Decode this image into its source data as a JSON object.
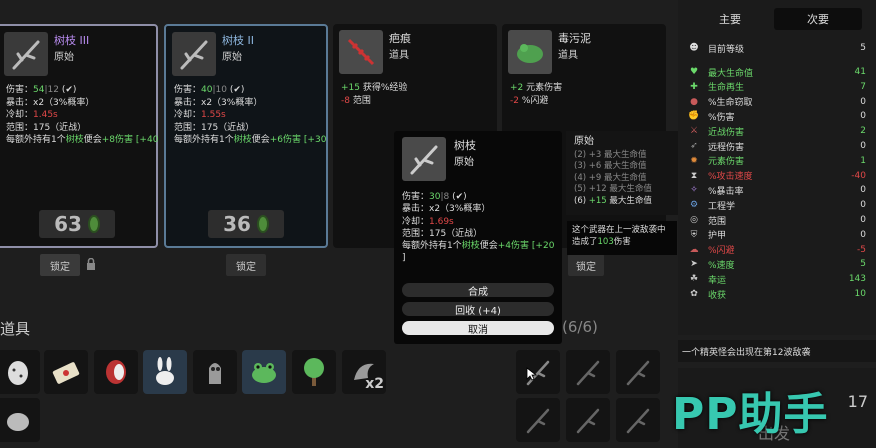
{
  "shop": {
    "card1": {
      "name": "树枝 III",
      "tier": "原始",
      "lines": [
        "伤害：",
        "54",
        "|",
        "12",
        "(",
        "✔",
        ")",
        "暴击：x2（3%概率）",
        "冷却：",
        "1.45s",
        "范围：175（近战）",
        "每额外持有1个",
        "树枝",
        "使会",
        "+8伤害",
        "[+40",
        "]"
      ],
      "price": "63",
      "lock_label": "锁定"
    },
    "card2": {
      "name": "树枝 II",
      "tier": "原始",
      "price": "36",
      "lock_label": "锁定"
    },
    "card3": {
      "name": "疤痕",
      "tier": "道具",
      "line1_prefix": "+15",
      "line1_text": "获得%经验",
      "line2_prefix": "-8",
      "line2_text": "范围"
    },
    "card4": {
      "name": "毒污泥",
      "tier": "道具",
      "line1_prefix": "+2",
      "line1_text": "元素伤害",
      "line2_prefix": "-2",
      "line2_text": "%闪避",
      "lock_label": "锁定"
    }
  },
  "card_common": {
    "damage_label": "伤害：",
    "crit_line": "暴击：x2（3%概率）",
    "cooldown_label": "冷却：",
    "range_line": "范围：175（近战）",
    "bonus_prefix": "每额外持有1个",
    "bonus_item": "树枝",
    "bonus_mid": "便会"
  },
  "card1_vals": {
    "dmg": "54",
    "sep": "|",
    "dmg2": "12",
    "cd": "1.45s",
    "bonus": "+8伤害",
    "bonus_total": "[+40"
  },
  "card2_vals": {
    "dmg": "40",
    "sep": "|",
    "dmg2": "10",
    "cd": "1.55s",
    "bonus": "+6伤害",
    "bonus_total": "[+30"
  },
  "popup": {
    "name": "树枝",
    "tier": "原始",
    "damage_label": "伤害：",
    "dmg": "30",
    "sep": "|",
    "dmg2": "8",
    "crit_line": "暴击：x2（3%概率）",
    "cooldown_label": "冷却：",
    "cd": "1.69s",
    "range_line": "范围：175（近战）",
    "bonus_prefix": "每额外持有1个",
    "bonus_item": "树枝",
    "bonus_mid": "便会",
    "bonus": "+4伤害",
    "bonus_total": "[+20",
    "bonus_end": "]",
    "combine_label": "合成",
    "recycle_label": "回收 (+4)",
    "cancel_label": "取消"
  },
  "tier_panel": {
    "title": "原始",
    "lines": [
      "(2) +3 最大生命值",
      "(3) +6 最大生命值",
      "(4) +9 最大生命值",
      "(5) +12 最大生命值"
    ],
    "active_prefix": "(6)",
    "active_value": "+15",
    "active_text": "最大生命值"
  },
  "tooltip": {
    "text1": "这个武器在上一波敌袭中造成了",
    "value": "103",
    "text2": "伤害"
  },
  "stats": {
    "tab_main": "主要",
    "tab_secondary": "次要",
    "level_label": "目前等级",
    "level_value": "5",
    "rows": [
      {
        "label": "最大生命值",
        "value": "41",
        "color": "#6bd96b"
      },
      {
        "label": "生命再生",
        "value": "7",
        "color": "#6bd96b"
      },
      {
        "label": "%生命窃取",
        "value": "0",
        "color": "#dddddd"
      },
      {
        "label": "%伤害",
        "value": "0",
        "color": "#dddddd"
      },
      {
        "label": "近战伤害",
        "value": "2",
        "color": "#6bd96b"
      },
      {
        "label": "远程伤害",
        "value": "0",
        "color": "#dddddd"
      },
      {
        "label": "元素伤害",
        "value": "1",
        "color": "#6bd96b"
      },
      {
        "label": "%攻击速度",
        "value": "-40",
        "color": "#e04848"
      },
      {
        "label": "%暴击率",
        "value": "0",
        "color": "#dddddd"
      },
      {
        "label": "工程学",
        "value": "0",
        "color": "#dddddd"
      },
      {
        "label": "范围",
        "value": "0",
        "color": "#dddddd"
      },
      {
        "label": "护甲",
        "value": "0",
        "color": "#dddddd"
      },
      {
        "label": "%闪避",
        "value": "-5",
        "color": "#e04848"
      },
      {
        "label": "%速度",
        "value": "5",
        "color": "#6bd96b"
      },
      {
        "label": "幸运",
        "value": "143",
        "color": "#6bd96b"
      },
      {
        "label": "收获",
        "value": "10",
        "color": "#6bd96b"
      }
    ]
  },
  "items_title": "道具",
  "weapons_count": "(6/6)",
  "elite_notice": "一个精英怪会出现在第12波敌袭",
  "item_stack": "x2",
  "go_label": "出发",
  "wave_num": "17",
  "watermark": "PP助手",
  "colors": {
    "accent_green": "#6bd96b",
    "danger_red": "#e04848",
    "purple": "#b98cf0"
  }
}
